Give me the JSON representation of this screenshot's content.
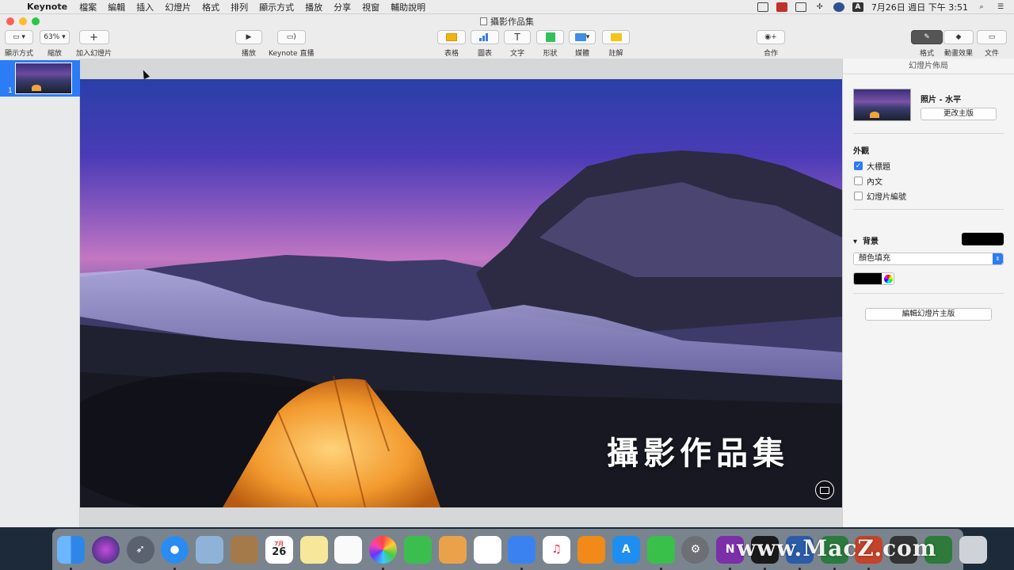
{
  "menubar": {
    "app_name": "Keynote",
    "items": [
      "檔案",
      "編輯",
      "插入",
      "幻燈片",
      "格式",
      "排列",
      "顯示方式",
      "播放",
      "分享",
      "視窗",
      "輔助說明"
    ],
    "tray_input": "A",
    "clock": "7月26日 週日 下午 3:51"
  },
  "window": {
    "title": "攝影作品集"
  },
  "toolbar": {
    "view_label": "顯示方式",
    "zoom_value": "63%",
    "zoom_label": "縮放",
    "add_slide_label": "加入幻燈片",
    "play_label": "播放",
    "keynote_live_label": "Keynote 直播",
    "table_label": "表格",
    "chart_label": "圖表",
    "text_label": "文字",
    "shape_label": "形狀",
    "media_label": "媒體",
    "comment_label": "註解",
    "collaborate_label": "合作",
    "format_label": "格式",
    "animate_label": "動畫效果",
    "document_label": "文件"
  },
  "navigator": {
    "slides": [
      {
        "number": "1"
      }
    ]
  },
  "slide": {
    "title": "攝影作品集"
  },
  "inspector": {
    "header": "幻燈片佈局",
    "layout_name": "照片 - 水平",
    "change_master": "更改主版",
    "appearance_title": "外觀",
    "checks": [
      {
        "label": "大標題",
        "checked": true
      },
      {
        "label": "內文",
        "checked": false
      },
      {
        "label": "幻燈片編號",
        "checked": false
      }
    ],
    "background_title": "背景",
    "fill_type": "顏色填充",
    "edit_master": "編輯幻燈片主版"
  },
  "dock": {
    "calendar_month": "7月",
    "calendar_day": "26",
    "onenote_letter": "N"
  },
  "watermark": "www.MacZ.com",
  "colors": {
    "accent": "#2c7cf6",
    "menubar_bg": "#ececec",
    "background_swatch": "#000000"
  }
}
